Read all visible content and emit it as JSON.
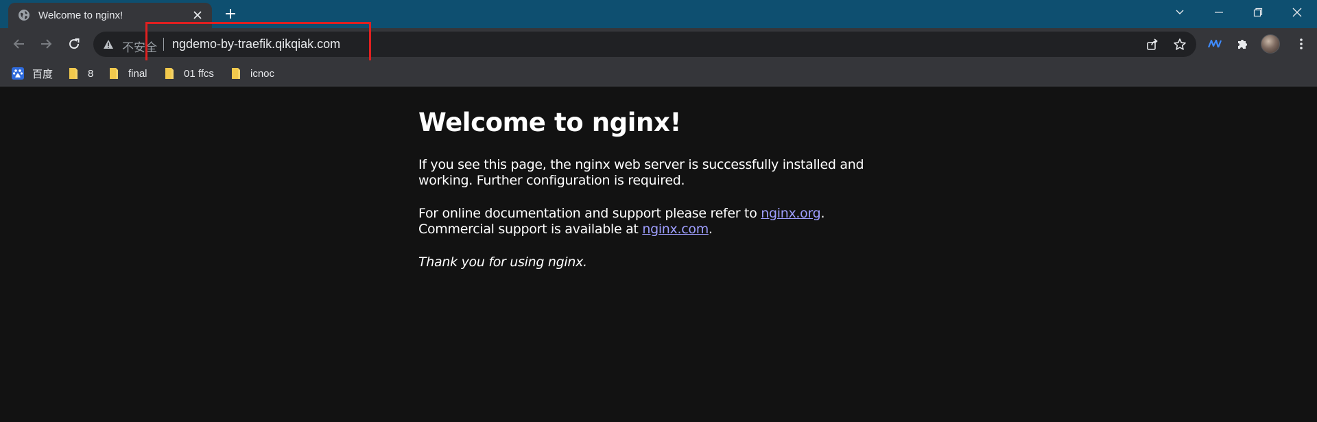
{
  "tab": {
    "title": "Welcome to nginx!"
  },
  "omnibox": {
    "security_label": "不安全",
    "url": "ngdemo-by-traefik.qikqiak.com"
  },
  "bookmarks": [
    {
      "label": "百度",
      "icon": "baidu-icon"
    },
    {
      "label": "8",
      "icon": "folder-icon"
    },
    {
      "label": "final",
      "icon": "folder-icon"
    },
    {
      "label": "01 ffcs",
      "icon": "folder-icon"
    },
    {
      "label": "icnoc",
      "icon": "folder-icon"
    }
  ],
  "page": {
    "heading": "Welcome to nginx!",
    "para1": "If you see this page, the nginx web server is successfully installed and working. Further configuration is required.",
    "para2_prefix": "For online documentation and support please refer to ",
    "link_org": "nginx.org",
    "para2_mid": ".",
    "para2_line2": "Commercial support is available at ",
    "link_com": "nginx.com",
    "para2_end": ".",
    "thanks": "Thank you for using nginx."
  },
  "colors": {
    "titlebar": "#0e4f70",
    "toolbar": "#35363a",
    "omnibox": "#202124",
    "page_bg": "#121212",
    "link": "#9e9eff",
    "highlight": "#e02020"
  }
}
